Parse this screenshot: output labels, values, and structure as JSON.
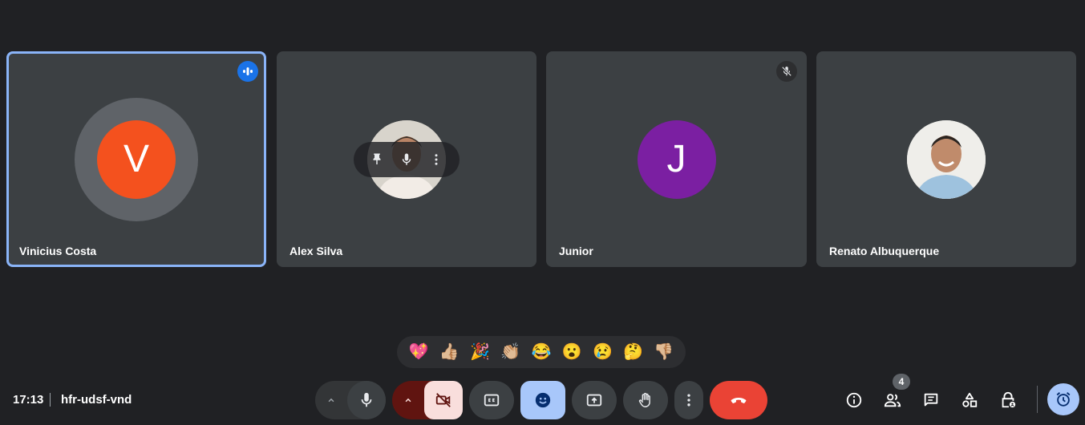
{
  "participants": [
    {
      "name": "Vinicius Costa",
      "initial": "V",
      "color": "#f4511e",
      "speaking": true
    },
    {
      "name": "Alex Silva",
      "photo": true
    },
    {
      "name": "Junior",
      "initial": "J",
      "color": "#7b1fa2",
      "muted": true
    },
    {
      "name": "Renato Albuquerque",
      "photo": true
    }
  ],
  "reactions": [
    "💖",
    "👍🏼",
    "🎉",
    "👏🏼",
    "😂",
    "😮",
    "😢",
    "🤔",
    "👎🏼"
  ],
  "footer": {
    "time": "17:13",
    "meeting_code": "hfr-udsf-vnd",
    "people_count": "4"
  },
  "icons": {
    "more_audio": "chevron-up-icon",
    "mic": "mic-icon",
    "camera_off": "camera-off-icon",
    "captions": "closed-captions-icon",
    "reactions": "emoji-icon",
    "present": "present-screen-icon",
    "raise_hand": "hand-icon",
    "more": "more-vert-icon",
    "end_call": "end-call-icon",
    "info": "info-icon",
    "people": "people-icon",
    "chat": "chat-icon",
    "activities": "shapes-icon",
    "host_controls": "lock-person-icon",
    "timer": "alarm-icon"
  },
  "colors": {
    "end_call": "#ea4335",
    "reactions_active": "#a8c7fa",
    "camera_off": "#f9dedc",
    "camera_off_arrow": "#601410",
    "speaking_outline": "#8ab4f8"
  }
}
